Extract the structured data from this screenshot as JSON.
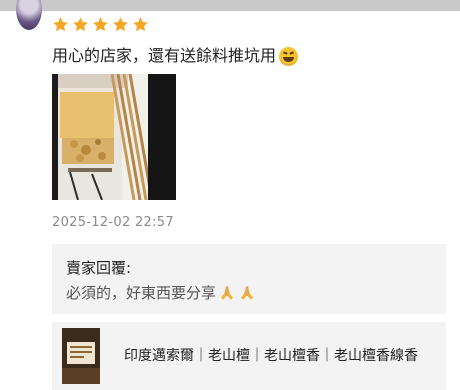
{
  "review": {
    "rating": 5,
    "rating_max": 5,
    "star_color": "#f5a623",
    "text": "用心的店家，還有送餘料推坑用",
    "emoji": "grinning-squinting-face-emoji",
    "photo": "incense-sticks-photo",
    "timestamp": "2025-12-02 22:57"
  },
  "seller_reply": {
    "label": "賣家回覆:",
    "text": "必須的，好東西要分享",
    "emoji": "folded-hands-emoji"
  },
  "product": {
    "thumbnail": "product-thumbnail",
    "title": "印度邁索爾｜老山檀｜老山檀香｜老山檀香線香"
  },
  "colors": {
    "text_primary": "#222222",
    "text_secondary": "#555555",
    "text_muted": "#8a8a8a",
    "panel_bg": "#f3f3f3"
  }
}
